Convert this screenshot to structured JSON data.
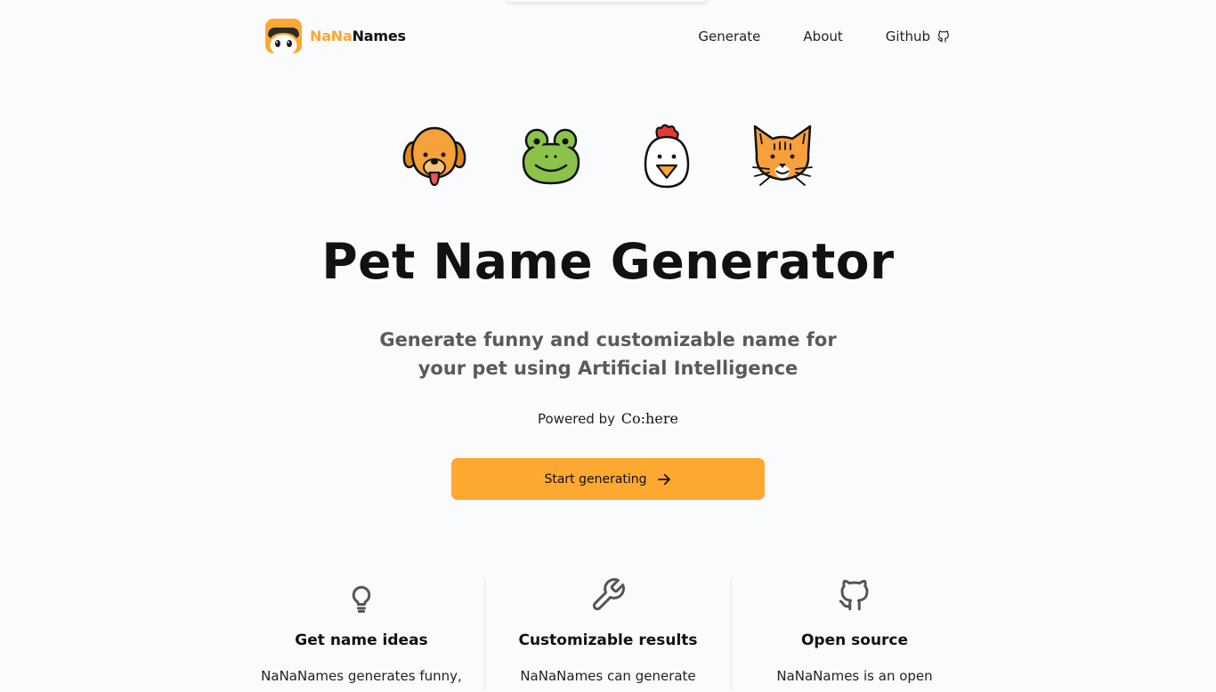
{
  "header": {
    "logo_text_a": "NaNa",
    "logo_text_b": "Names",
    "nav": [
      {
        "label": "Generate"
      },
      {
        "label": "About"
      },
      {
        "label": "Github",
        "icon": "github-icon"
      }
    ]
  },
  "hero": {
    "animals": [
      "dog-icon",
      "frog-icon",
      "chicken-icon",
      "cat-icon"
    ],
    "title": "Pet Name Generator",
    "subtitle_line1": "Generate funny and customizable name for",
    "subtitle_line2": "your pet using Artificial Intelligence",
    "powered_by": "Powered by",
    "powered_brand": "Co:here",
    "cta_label": "Start generating"
  },
  "features": [
    {
      "icon": "lightbulb-icon",
      "title": "Get name ideas",
      "text": "NaNaNames generates funny,"
    },
    {
      "icon": "wrench-icon",
      "title": "Customizable results",
      "text": "NaNaNames can generate"
    },
    {
      "icon": "github-icon",
      "title": "Open source",
      "text": "NaNaNames is an open"
    }
  ],
  "colors": {
    "accent": "#fda831",
    "background": "#fafbfd"
  }
}
